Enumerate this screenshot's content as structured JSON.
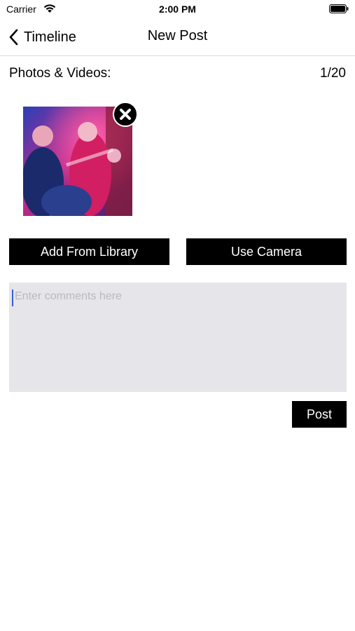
{
  "status_bar": {
    "carrier": "Carrier",
    "time": "2:00 PM"
  },
  "nav": {
    "back_label": "Timeline",
    "title": "New Post"
  },
  "media": {
    "section_label": "Photos & Videos:",
    "count": "1/20"
  },
  "actions": {
    "library_label": "Add From Library",
    "camera_label": "Use Camera"
  },
  "comments": {
    "placeholder": "Enter comments here",
    "value": ""
  },
  "post": {
    "label": "Post"
  },
  "icons": [
    "wifi-icon",
    "battery-icon",
    "chevron-left-icon",
    "close-circle-icon"
  ],
  "colors": {
    "button_bg": "#000000",
    "input_bg": "#e5e5ea",
    "caret": "#3b5bdb"
  }
}
